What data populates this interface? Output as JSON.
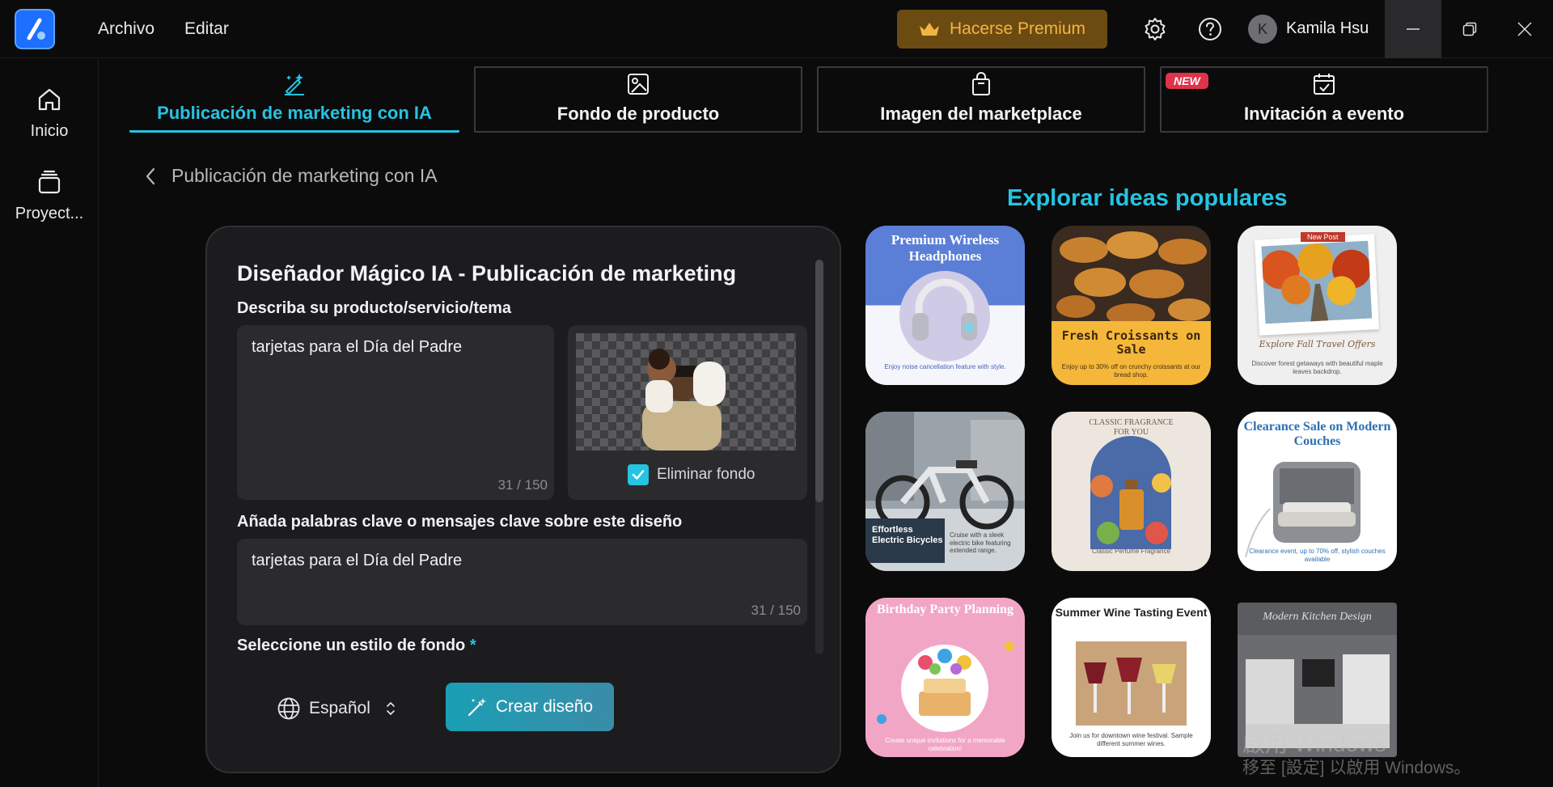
{
  "menu": {
    "file": "Archivo",
    "edit": "Editar"
  },
  "header": {
    "premium_label": "Hacerse Premium",
    "avatar_initial": "K",
    "user_name": "Kamila Hsu"
  },
  "sidebar": {
    "items": [
      {
        "label": "Inicio",
        "icon": "home-icon"
      },
      {
        "label": "Proyect...",
        "icon": "layers-icon"
      }
    ]
  },
  "tabs": [
    {
      "label": "Publicación de marketing con IA",
      "icon": "magic-pen-icon",
      "active": true
    },
    {
      "label": "Fondo de producto",
      "icon": "image-edit-icon",
      "active": false
    },
    {
      "label": "Imagen del marketplace",
      "icon": "shopping-bag-icon",
      "active": false
    },
    {
      "label": "Invitación a evento",
      "icon": "calendar-check-icon",
      "active": false,
      "badge": "NEW"
    }
  ],
  "breadcrumb": {
    "label": "Publicación de marketing con IA"
  },
  "panel": {
    "title": "Diseñador Mágico IA - Publicación de marketing",
    "describe_label": "Describa su producto/servicio/tema",
    "describe_value": "tarjetas para el Día del Padre",
    "describe_counter": "31 / 150",
    "remove_bg_label": "Eliminar fondo",
    "remove_bg_checked": true,
    "keywords_label": "Añada palabras clave o mensajes clave sobre este diseño",
    "keywords_value": "tarjetas para el Día del Padre",
    "keywords_counter": "31 / 150",
    "bg_style_label": "Seleccione un estilo de fondo",
    "required_mark": "*",
    "language": "Español",
    "create_label": "Crear diseño"
  },
  "ideas": {
    "title": "Explorar ideas populares",
    "cards": [
      {
        "title": "Premium Wireless Headphones",
        "sub": "Enjoy noise cancellation feature with style."
      },
      {
        "title": "Fresh Croissants on Sale",
        "sub": "Enjoy up to 30% off on crunchy croissants at our bread shop."
      },
      {
        "title": "New Post",
        "sub": "Discover forest getaways with beautiful maple leaves backdrop.",
        "script": "Explore Fall Travel Offers"
      },
      {
        "title": "Effortless Electric Bicycles",
        "sub": "Cruise with a sleek electric bike featuring extended range."
      },
      {
        "title": "CLASSIC FRAGRANCE FOR YOU",
        "sub": "Classic Perfume Fragrance"
      },
      {
        "title": "Clearance Sale on Modern Couches",
        "sub": "Clearance event, up to 70% off, stylish couches available"
      },
      {
        "title": "Birthday Party Planning",
        "sub": "Create unique invitations for a memorable celebration!"
      },
      {
        "title": "Summer Wine Tasting Event",
        "sub": "Join us for downtown wine festival. Sample different summer wines."
      },
      {
        "title": "Modern Kitchen Design",
        "sub": ""
      }
    ]
  },
  "watermark": {
    "line1": "啟用 Windows",
    "line2": "移至 [設定] 以啟用 Windows。"
  },
  "colors": {
    "accent": "#25c4e0",
    "premium_bg": "#6b4b12",
    "premium_text": "#f3b541",
    "badge": "#e0324b"
  }
}
